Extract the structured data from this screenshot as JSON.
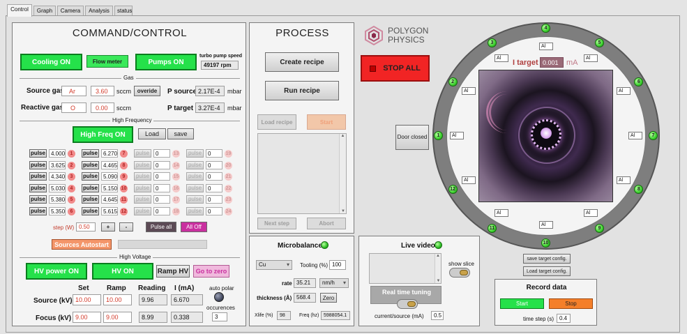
{
  "tabs": [
    "Control",
    "Graph",
    "Camera",
    "Analysis",
    "status"
  ],
  "command": {
    "title": "COMMAND/CONTROL",
    "cooling": "Cooling ON",
    "flow": "Flow meter",
    "pumps": "Pumps ON",
    "turbo_label": "turbo pump speed",
    "turbo_value": "49197 rpm",
    "gas_group": "Gas",
    "source_gas_label": "Source gas",
    "source_gas": "Ar",
    "source_flow": "3.60",
    "sccm1": "sccm",
    "override": "overide",
    "p_source_label": "P source",
    "p_source": "2.17E-4",
    "mbar1": "mbar",
    "reactive_gas_label": "Reactive gas",
    "reactive_gas": "O",
    "reactive_flow": "0.00",
    "sccm2": "sccm",
    "p_target_label": "P target",
    "p_target": "3.27E-4",
    "mbar2": "mbar",
    "hf_group": "High Frequency",
    "hf_on": "High Freq ON",
    "load": "Load",
    "save": "save",
    "pulse_label": "pulse",
    "col1": [
      "4.000",
      "3.625",
      "4.340",
      "5.030",
      "5.380",
      "5.350"
    ],
    "col2": [
      "6.270",
      "4.465",
      "5.090",
      "5.150",
      "4.645",
      "5.615"
    ],
    "col3": [
      "0",
      "0",
      "0",
      "0",
      "0",
      "0"
    ],
    "col4": [
      "0",
      "0",
      "0",
      "0",
      "0",
      "0"
    ],
    "n1": [
      "1",
      "2",
      "3",
      "4",
      "5",
      "6"
    ],
    "n2": [
      "7",
      "8",
      "9",
      "10",
      "11",
      "12"
    ],
    "n3": [
      "13",
      "14",
      "15",
      "16",
      "17",
      "18"
    ],
    "n4": [
      "19",
      "20",
      "21",
      "22",
      "23",
      "24"
    ],
    "step_label": "step (W)",
    "step_value": "0.50",
    "plus": "+",
    "minus": "-",
    "pulse_all": "Pulse all",
    "all_off": "All Off",
    "autostart": "Sources Autostart",
    "hv_group": "High Voltage",
    "hv_power": "HV power ON",
    "hv_on": "HV ON",
    "ramp_hv": "Ramp HV",
    "go_zero": "Go to zero",
    "h_set": "Set",
    "h_ramp": "Ramp",
    "h_reading": "Reading",
    "h_i": "I (mA)",
    "auto_polar": "auto polar",
    "occurences": "occurences",
    "source_kv_label": "Source (kV)",
    "source_set": "10.00",
    "source_ramp": "10.00",
    "source_reading": "9.96",
    "source_i": "6.670",
    "focus_kv_label": "Focus (kV)",
    "focus_set": "9.00",
    "focus_ramp": "9.00",
    "focus_reading": "8.99",
    "focus_i": "0.338",
    "occ_value": "3"
  },
  "process": {
    "title": "PROCESS",
    "create": "Create recipe",
    "run": "Run recipe",
    "load": "Load recipe",
    "start": "Start",
    "next": "Next step",
    "abort": "Abort"
  },
  "micro": {
    "title": "Microbalance",
    "material": "Cu",
    "tooling_label": "Tooling (%)",
    "tooling": "100",
    "rate_label": "rate",
    "rate": "35.21",
    "rate_unit": "nm/h",
    "thick_label": "thickness (Å)",
    "thick": "568.4",
    "zero": "Zero",
    "xlife_label": "Xlife (%)",
    "xlife": "98",
    "freq_label": "Freq (hz)",
    "freq": "5988054.1"
  },
  "video": {
    "title": "Live video",
    "show_slice": "show slice",
    "rt_title": "Real time tuning",
    "current_label": "current/source (mA)",
    "current": "0.5"
  },
  "logo": {
    "line1": "POLYGON",
    "line2": "PHYSICS"
  },
  "stop_all": "STOP ALL",
  "target": {
    "i_target_label": "I target",
    "i_target": "0.001",
    "unit": "mA",
    "door": "Door closed",
    "al": "Al",
    "nums": [
      "1",
      "2",
      "3",
      "4",
      "5",
      "6",
      "7",
      "8",
      "9",
      "10",
      "11",
      "12"
    ],
    "save_config": "save target config.",
    "load_config": "Load target config."
  },
  "record": {
    "title": "Record data",
    "start": "Start",
    "stop": "Stop",
    "time_step_label": "time step (s)",
    "time_step": "0.4"
  },
  "colors": {
    "green": "#25e14a",
    "stop_red": "#f12424",
    "orange": "#f47f2a",
    "magenta": "#c9309f"
  }
}
